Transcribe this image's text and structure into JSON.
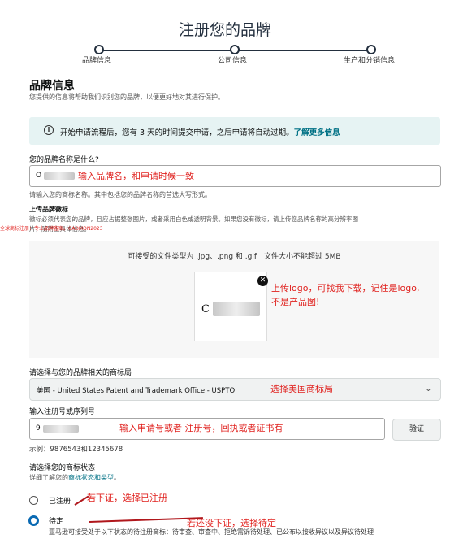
{
  "page": {
    "title": "注册您的品牌"
  },
  "steps": [
    {
      "label": "品牌信息"
    },
    {
      "label": "公司信息"
    },
    {
      "label": "生产和分销信息"
    }
  ],
  "section": {
    "title": "品牌信息",
    "description": "您提供的信息将帮助我们识别您的品牌，以便更好地对其进行保护。"
  },
  "banner": {
    "text": "开始申请流程后，您有 3 天的时间提交申请，之后申请将自动过期。",
    "link": "了解更多信息",
    "icon": "info-icon"
  },
  "brand_name": {
    "label": "您的品牌名称是什么?",
    "value_prefix": "O",
    "annotation": "输入品牌名，和申请时候一致",
    "help": "请输入您的商标名称。其中包括您的品牌名称的首选大写形式。"
  },
  "logo": {
    "label": "上传品牌徽标",
    "help_line1": "徽标必须代表您的品牌，且应占据整张图片，或者采用白色或透明背景。如果您没有徽标，请上传您品牌名称的高分辨率图",
    "help_line2": "片，随附上具体信息。",
    "watermark": "全球商标注册：专业品牌备案。CADMON2023",
    "accepted_types": "可接受的文件类型为 .jpg、.png 和 .gif　文件大小不能超过 5MB",
    "preview_letter": "C",
    "close_icon": "close-icon",
    "annotation_line1": "上传logo，可找我下载，记住是logo,",
    "annotation_line2": "不是产品图!"
  },
  "trademark_office": {
    "label": "请选择与您的品牌相关的商标局",
    "selected": "美国 - United States Patent and Trademark Office - USPTO",
    "annotation": "选择美国商标局"
  },
  "registration_number": {
    "label": "输入注册号或序列号",
    "value_prefix": "9",
    "annotation": "输入申请号或者 注册号，回执或者证书有",
    "verify_button": "验证",
    "example": "示例：9876543和12345678"
  },
  "trademark_status": {
    "label": "请选择您的商标状态",
    "help_prefix": "详细了解您的",
    "help_link": "商标状态和类型",
    "help_suffix": "。",
    "options": [
      {
        "label": "已注册",
        "selected": false,
        "annotation": "若下证，选择已注册"
      },
      {
        "label": "待定",
        "selected": true,
        "annotation": "若还没下证，选择待定"
      }
    ],
    "pending_note": "亚马逊可接受处于以下状态的待注册商标：待审查、审查中、拒绝需诉待处理、已公布以接收异议以及异议待处理"
  },
  "colors": {
    "accent": "#007185",
    "annotation": "#e0221f",
    "arrow": "#b0171c"
  }
}
